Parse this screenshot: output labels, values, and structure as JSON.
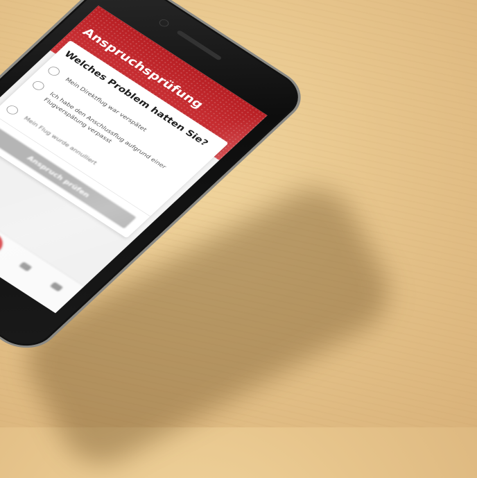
{
  "header": {
    "title": "Anspruchsprüfung"
  },
  "question": "Welches Problem hatten Sie?",
  "options": [
    {
      "label": "Mein Direktflug war verspätet"
    },
    {
      "label": "Ich habe den Anschlussflug aufgrund einer Flugverspätung verpasst"
    },
    {
      "label": "Mein Flug wurde annulliert"
    }
  ],
  "check_button": {
    "label": "Anspruch prüfen"
  },
  "colors": {
    "brand_red": "#c8282d",
    "button_disabled": "#b5b5b5",
    "table_wood": "#e7c58c"
  },
  "icons": {
    "tab_bar": [
      "tab-icon-1",
      "tab-icon-2",
      "center-action-icon",
      "tab-icon-4",
      "tab-icon-5"
    ]
  }
}
